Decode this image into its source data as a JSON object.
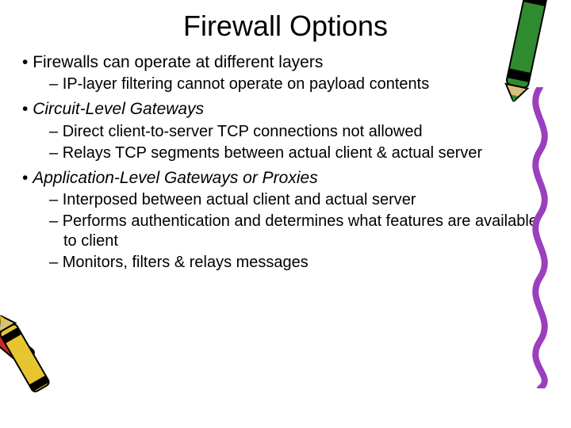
{
  "title": "Firewall Options",
  "bullets": {
    "b1": {
      "text": "Firewalls can operate at different layers",
      "subs": [
        "IP-layer filtering cannot operate on payload contents"
      ]
    },
    "b2": {
      "text": "Circuit-Level Gateways",
      "subs": [
        "Direct client-to-server TCP connections not allowed",
        "Relays TCP segments between actual client & actual server"
      ]
    },
    "b3": {
      "text": "Application-Level Gateways or Proxies",
      "subs": [
        "Interposed between actual client and actual server",
        "Performs authentication and determines what features are available to client",
        "Monitors, filters & relays messages"
      ]
    }
  }
}
